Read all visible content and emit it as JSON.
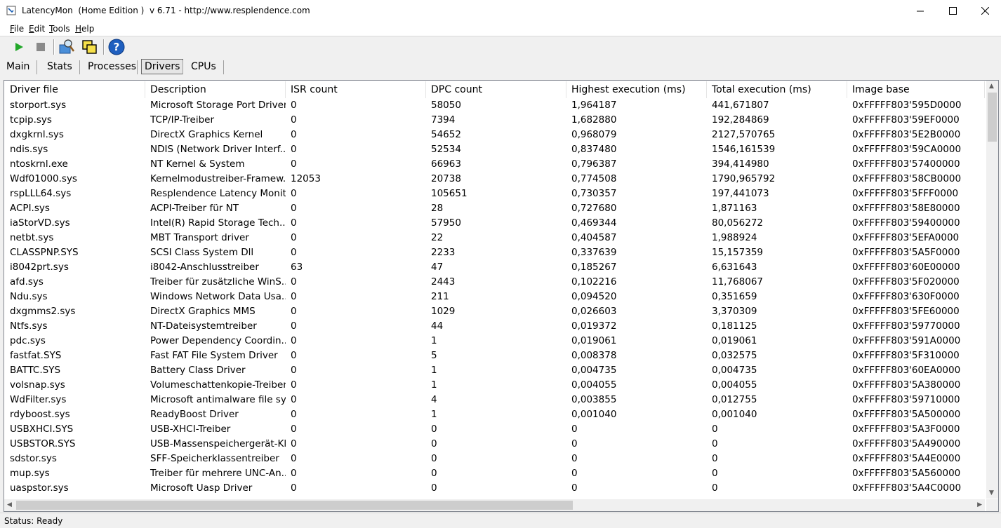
{
  "window": {
    "title": "LatencyMon  (Home Edition )  v 6.71 - http://www.resplendence.com"
  },
  "menu": [
    {
      "label": "File",
      "key": "F",
      "rest": "ile"
    },
    {
      "label": "Edit",
      "key": "E",
      "rest": "dit"
    },
    {
      "label": "Tools",
      "key": "T",
      "rest": "ools"
    },
    {
      "label": "Help",
      "key": "H",
      "rest": "elp"
    }
  ],
  "toolbar": {
    "icons": [
      "play-icon",
      "stop-icon",
      "analyzer-icon",
      "windows-icon",
      "help-icon"
    ],
    "play_color": "#22a82a",
    "help_color": "#1f5fbf"
  },
  "tabs": [
    {
      "label": "Main"
    },
    {
      "label": "Stats"
    },
    {
      "label": "Processes"
    },
    {
      "label": "Drivers",
      "active": true
    },
    {
      "label": "CPUs"
    }
  ],
  "table": {
    "columns": [
      "Driver file",
      "Description",
      "ISR count",
      "DPC count",
      "Highest execution (ms)",
      "Total execution (ms)",
      "Image base"
    ],
    "rows": [
      [
        "storport.sys",
        "Microsoft Storage Port Driver",
        "0",
        "58050",
        "1,964187",
        "441,671807",
        "0xFFFFF803'595D0000"
      ],
      [
        "tcpip.sys",
        "TCP/IP-Treiber",
        "0",
        "7394",
        "1,682880",
        "192,284869",
        "0xFFFFF803'59EF0000"
      ],
      [
        "dxgkrnl.sys",
        "DirectX Graphics Kernel",
        "0",
        "54652",
        "0,968079",
        "2127,570765",
        "0xFFFFF803'5E2B0000"
      ],
      [
        "ndis.sys",
        "NDIS (Network Driver Interf...",
        "0",
        "52534",
        "0,837480",
        "1546,161539",
        "0xFFFFF803'59CA0000"
      ],
      [
        "ntoskrnl.exe",
        "NT Kernel & System",
        "0",
        "66963",
        "0,796387",
        "394,414980",
        "0xFFFFF803'57400000"
      ],
      [
        "Wdf01000.sys",
        "Kernelmodustreiber-Framew...",
        "12053",
        "20738",
        "0,774508",
        "1790,965792",
        "0xFFFFF803'58CB0000"
      ],
      [
        "rspLLL64.sys",
        "Resplendence Latency Monit...",
        "0",
        "105651",
        "0,730357",
        "197,441073",
        "0xFFFFF803'5FFF0000"
      ],
      [
        "ACPI.sys",
        "ACPI-Treiber für NT",
        "0",
        "28",
        "0,727680",
        "1,871163",
        "0xFFFFF803'58E80000"
      ],
      [
        "iaStorVD.sys",
        "Intel(R) Rapid Storage Tech...",
        "0",
        "57950",
        "0,469344",
        "80,056272",
        "0xFFFFF803'59400000"
      ],
      [
        "netbt.sys",
        "MBT Transport driver",
        "0",
        "22",
        "0,404587",
        "1,988924",
        "0xFFFFF803'5EFA0000"
      ],
      [
        "CLASSPNP.SYS",
        "SCSI Class System Dll",
        "0",
        "2233",
        "0,337639",
        "15,157359",
        "0xFFFFF803'5A5F0000"
      ],
      [
        "i8042prt.sys",
        "i8042-Anschlusstreiber",
        "63",
        "47",
        "0,185267",
        "6,631643",
        "0xFFFFF803'60E00000"
      ],
      [
        "afd.sys",
        "Treiber für zusätzliche WinS...",
        "0",
        "2443",
        "0,102216",
        "11,768067",
        "0xFFFFF803'5F020000"
      ],
      [
        "Ndu.sys",
        "Windows Network Data Usa...",
        "0",
        "211",
        "0,094520",
        "0,351659",
        "0xFFFFF803'630F0000"
      ],
      [
        "dxgmms2.sys",
        "DirectX Graphics MMS",
        "0",
        "1029",
        "0,026603",
        "3,370309",
        "0xFFFFF803'5FE60000"
      ],
      [
        "Ntfs.sys",
        "NT-Dateisystemtreiber",
        "0",
        "44",
        "0,019372",
        "0,181125",
        "0xFFFFF803'59770000"
      ],
      [
        "pdc.sys",
        "Power Dependency Coordin...",
        "0",
        "1",
        "0,019061",
        "0,019061",
        "0xFFFFF803'591A0000"
      ],
      [
        "fastfat.SYS",
        "Fast FAT File System Driver",
        "0",
        "5",
        "0,008378",
        "0,032575",
        "0xFFFFF803'5F310000"
      ],
      [
        "BATTC.SYS",
        "Battery Class Driver",
        "0",
        "1",
        "0,004735",
        "0,004735",
        "0xFFFFF803'60EA0000"
      ],
      [
        "volsnap.sys",
        "Volumeschattenkopie-Treiber",
        "0",
        "1",
        "0,004055",
        "0,004055",
        "0xFFFFF803'5A380000"
      ],
      [
        "WdFilter.sys",
        "Microsoft antimalware file sys...",
        "0",
        "4",
        "0,003855",
        "0,012755",
        "0xFFFFF803'59710000"
      ],
      [
        "rdyboost.sys",
        "ReadyBoost Driver",
        "0",
        "1",
        "0,001040",
        "0,001040",
        "0xFFFFF803'5A500000"
      ],
      [
        "USBXHCI.SYS",
        "USB-XHCI-Treiber",
        "0",
        "0",
        "0",
        "0",
        "0xFFFFF803'5A3F0000"
      ],
      [
        "USBSTOR.SYS",
        "USB-Massenspeichergerät-Kl...",
        "0",
        "0",
        "0",
        "0",
        "0xFFFFF803'5A490000"
      ],
      [
        "sdstor.sys",
        "SFF-Speicherklassentreiber",
        "0",
        "0",
        "0",
        "0",
        "0xFFFFF803'5A4E0000"
      ],
      [
        "mup.sys",
        "Treiber für mehrere UNC-An...",
        "0",
        "0",
        "0",
        "0",
        "0xFFFFF803'5A560000"
      ],
      [
        "uaspstor.sys",
        "Microsoft Uasp Driver",
        "0",
        "0",
        "0",
        "0",
        "0xFFFFF803'5A4C0000"
      ]
    ]
  },
  "status": {
    "text": "Status: Ready"
  }
}
